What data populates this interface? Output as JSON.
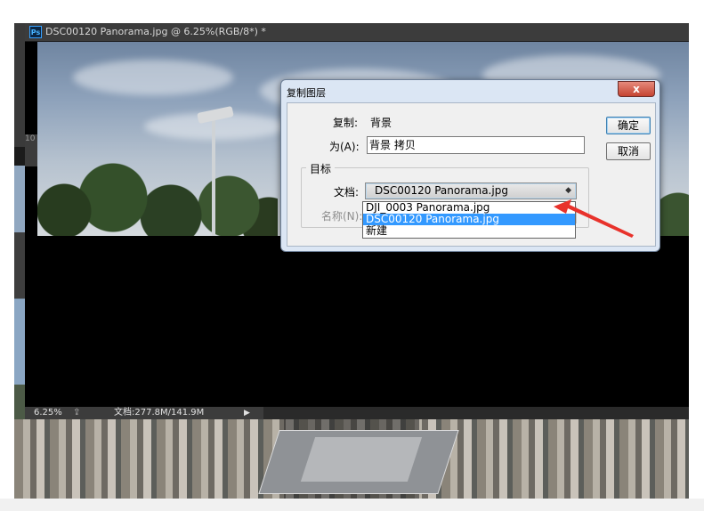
{
  "window": {
    "ps_badge": "Ps",
    "document_tab": "DSC00120 Panorama.jpg @ 6.25%(RGB/8*) *"
  },
  "left_strip_label": "10",
  "status_bar": {
    "zoom": "6.25%",
    "doc_info": "文档:277.8M/141.9M",
    "arrow": "▶"
  },
  "dialog": {
    "title": "复制图层",
    "close_glyph": "x",
    "duplicate_label": "复制:",
    "duplicate_value": "背景",
    "as_label": "为(A):",
    "as_value": "背景 拷贝",
    "ok_button": "确定",
    "cancel_button": "取消",
    "target_group": "目标",
    "document_label": "文档:",
    "document_value": "DSC00120 Panorama.jpg",
    "name_label": "名称(N):"
  },
  "dropdown": {
    "options": [
      "DJI_0003 Panorama.jpg",
      "DSC00120 Panorama.jpg",
      "新建"
    ],
    "selected_index": 1
  },
  "colors": {
    "selection": "#3399ff",
    "arrow": "#e8322b",
    "dialog_frame": "#dbe6f4",
    "close_button": "#c54432"
  }
}
